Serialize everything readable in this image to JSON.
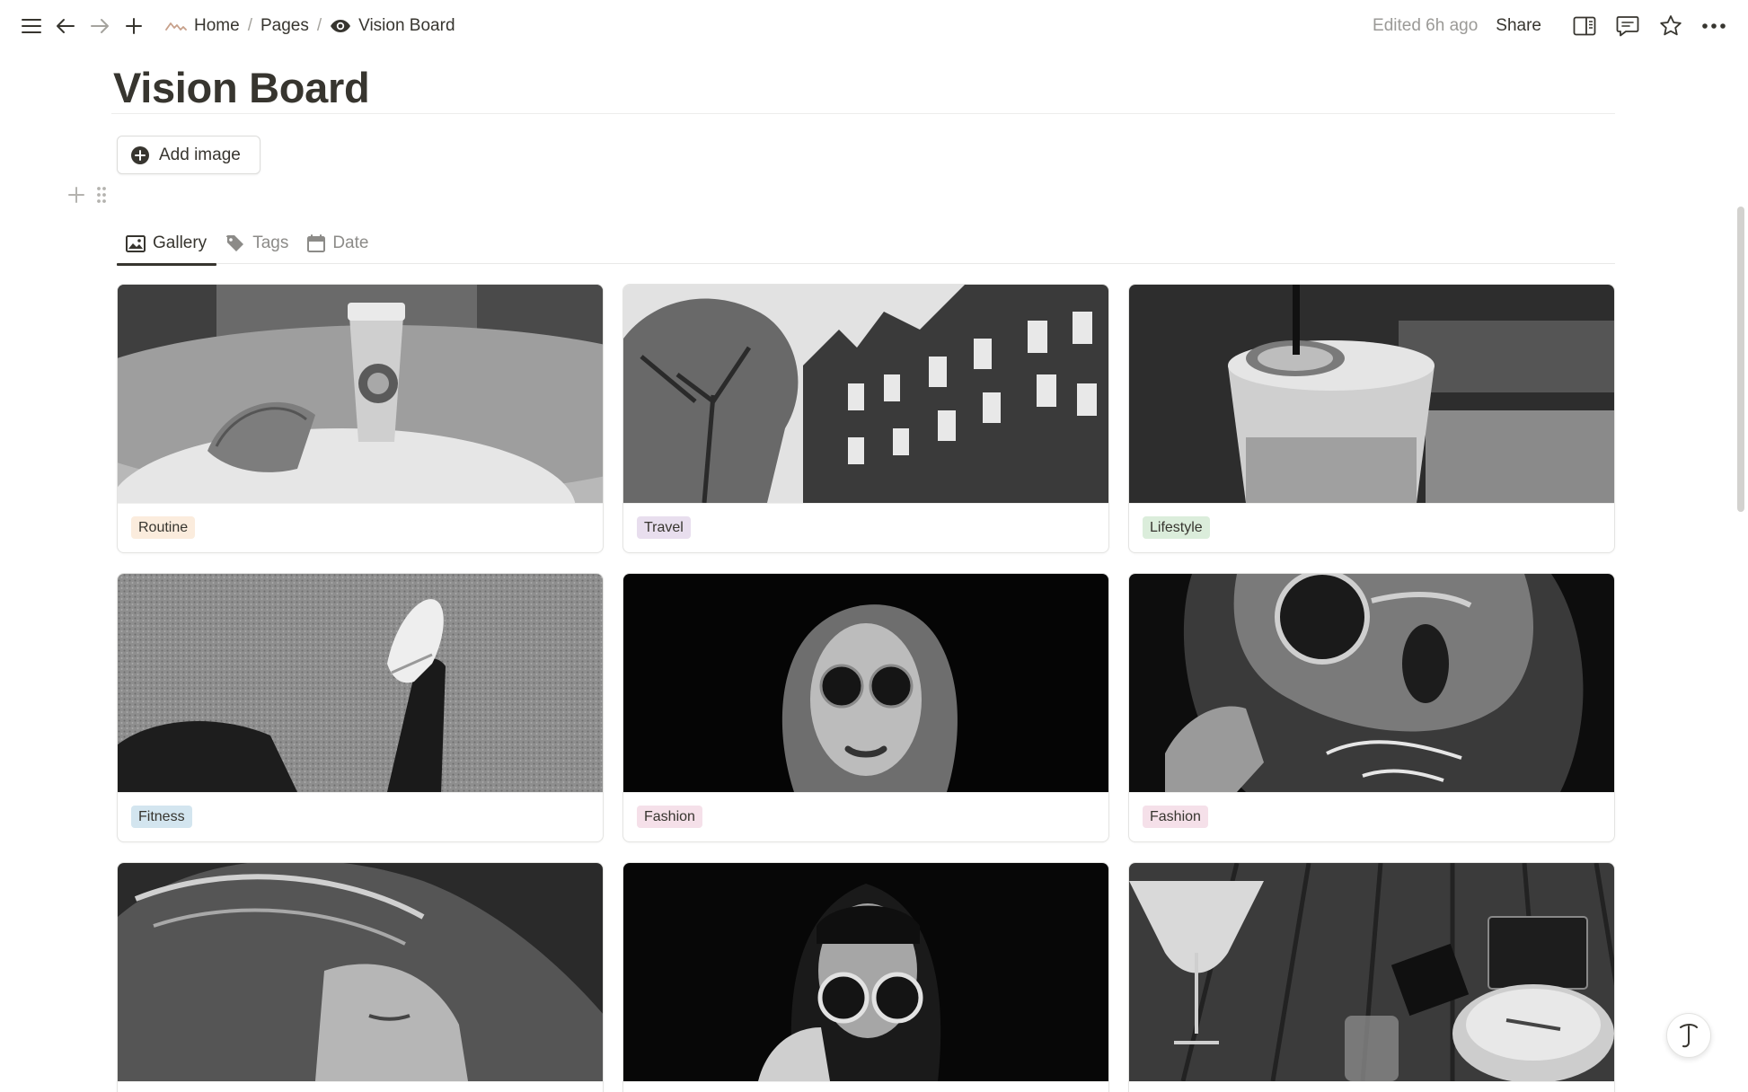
{
  "topbar": {
    "icons": [
      "menu-icon",
      "back-arrow-icon",
      "forward-arrow-icon",
      "plus-icon"
    ],
    "breadcrumbs": [
      {
        "label": "Home",
        "icon": "home-sketch-icon"
      },
      {
        "label": "Pages",
        "icon": ""
      },
      {
        "label": "Vision Board",
        "icon": "eye-icon"
      }
    ],
    "separator": "/",
    "edited": "Edited 6h ago",
    "share_label": "Share",
    "right_icons": [
      "side-peek-icon",
      "comment-icon",
      "star-icon",
      "more-icon"
    ]
  },
  "page": {
    "title": "Vision Board",
    "add_image_label": "Add image"
  },
  "tabs": [
    {
      "label": "Gallery",
      "icon": "image-icon",
      "active": true
    },
    {
      "label": "Tags",
      "icon": "tag-icon",
      "active": false
    },
    {
      "label": "Date",
      "icon": "calendar-icon",
      "active": false
    }
  ],
  "gallery": {
    "cards": [
      {
        "tag": "Routine",
        "tag_color": "#fbecdd"
      },
      {
        "tag": "Travel",
        "tag_color": "#e8deee"
      },
      {
        "tag": "Lifestyle",
        "tag_color": "#dbeddb"
      },
      {
        "tag": "Fitness",
        "tag_color": "#d3e5ef"
      },
      {
        "tag": "Fashion",
        "tag_color": "#f5e0e9"
      },
      {
        "tag": "Fashion",
        "tag_color": "#f5e0e9"
      },
      {
        "tag": "",
        "tag_color": "#ffffff"
      },
      {
        "tag": "",
        "tag_color": "#ffffff"
      },
      {
        "tag": "",
        "tag_color": "#ffffff"
      }
    ]
  },
  "colors": {
    "text": "#37352f",
    "muted": "#9b9a97",
    "border": "#e4e4e2"
  }
}
